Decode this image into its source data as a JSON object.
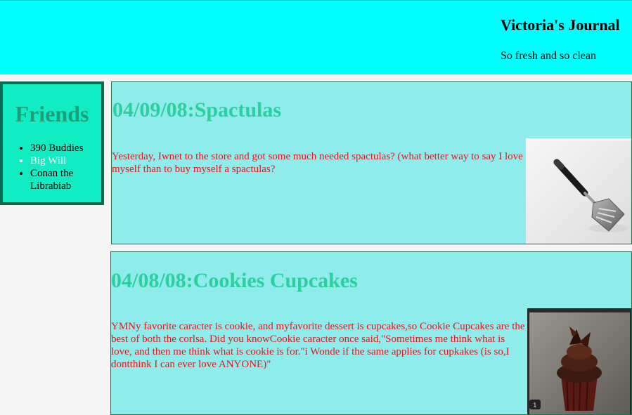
{
  "header": {
    "title": "Victoria's Journal",
    "subtitle": "So fresh and so clean"
  },
  "sidebar": {
    "heading": "Friends",
    "items": [
      {
        "label": "390 Buddies",
        "color": "#000000"
      },
      {
        "label": "Big Will",
        "color": "#ffffff"
      },
      {
        "label": "Conan the Librabiab",
        "color": "#000000"
      }
    ]
  },
  "posts": [
    {
      "title": "04/09/08:Spactulas",
      "body": "Yesterday, Iwnet to the store and got some much needed spactulas? (what better way to say I love myself than to buy myself a spactulas?",
      "image": "spatula-photo"
    },
    {
      "title": "04/08/08:Cookies Cupcakes",
      "body": "YMNy favorite caracter is cookie, and myfavorite dessert is cupcakes,so Cookie Cupcakes are the best of both the corlsa. Did you knowCookie caracter once said,\"Sometimes me think what is love, and then me think what is cookie is for.\"i Wonde if the same applies for cupkakes (is so,I dontthink I can ever love ANYONE)\"",
      "image": "cupcake-photo"
    }
  ],
  "colors": {
    "header_bg": "#00ffff",
    "sidebar_bg": "#12ecc2",
    "sidebar_border": "#0b6a50",
    "post_bg": "#8eecea",
    "post_title": "#2ccf9e",
    "post_text": "#e8141e"
  }
}
